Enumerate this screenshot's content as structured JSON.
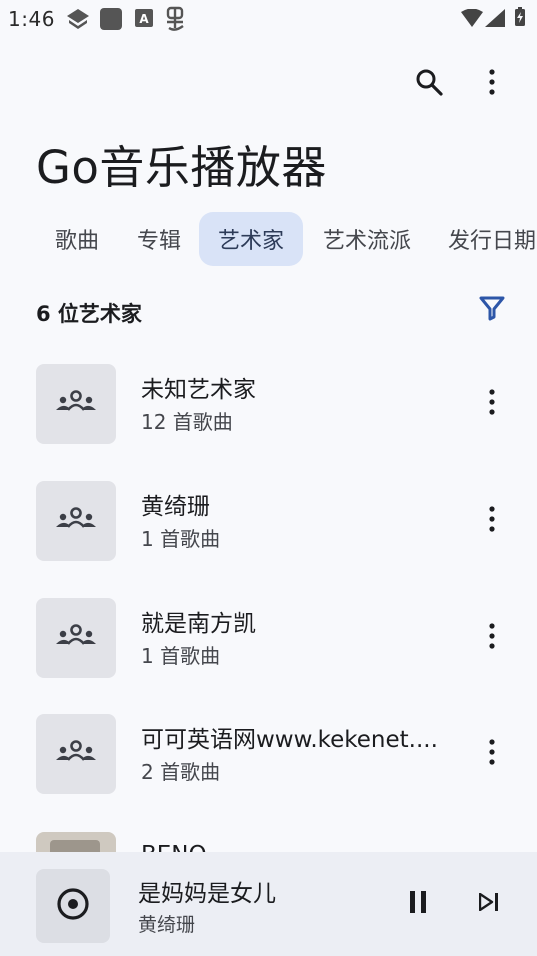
{
  "status_bar": {
    "time": "1:46",
    "icons": [
      "notification-badge-icon",
      "square-app-icon",
      "keyboard-a-icon",
      "debug-bug-icon",
      "wifi-icon",
      "cellular-signal-icon",
      "battery-charging-icon"
    ]
  },
  "header": {
    "title": "Go音乐播放器",
    "icons": [
      "search-icon",
      "more-vert-icon"
    ]
  },
  "tabs": [
    {
      "label": "歌曲",
      "active": false
    },
    {
      "label": "专辑",
      "active": false
    },
    {
      "label": "艺术家",
      "active": true
    },
    {
      "label": "艺术流派",
      "active": false
    },
    {
      "label": "发行日期",
      "active": false
    }
  ],
  "list_header": {
    "count_label": "6 位艺术家",
    "filter_icon": "filter-icon"
  },
  "artists": [
    {
      "name": "未知艺术家",
      "count": "12 首歌曲"
    },
    {
      "name": "黄绮珊",
      "count": "1 首歌曲"
    },
    {
      "name": "就是南方凯",
      "count": "1 首歌曲"
    },
    {
      "name": "可可英语网www.kekenet....",
      "count": "2 首歌曲"
    },
    {
      "name": "BENQ",
      "count": ""
    }
  ],
  "mini_player": {
    "title": "是妈妈是女儿",
    "artist": "黄绮珊",
    "icons": [
      "disc-icon",
      "pause-icon",
      "skip-next-icon"
    ]
  },
  "colors": {
    "background": "#f8f9fc",
    "accent": "#2d56a8",
    "active_tab_bg": "#d9e3f7",
    "thumb_bg": "#e2e3e8",
    "player_bg": "#eceef4"
  }
}
